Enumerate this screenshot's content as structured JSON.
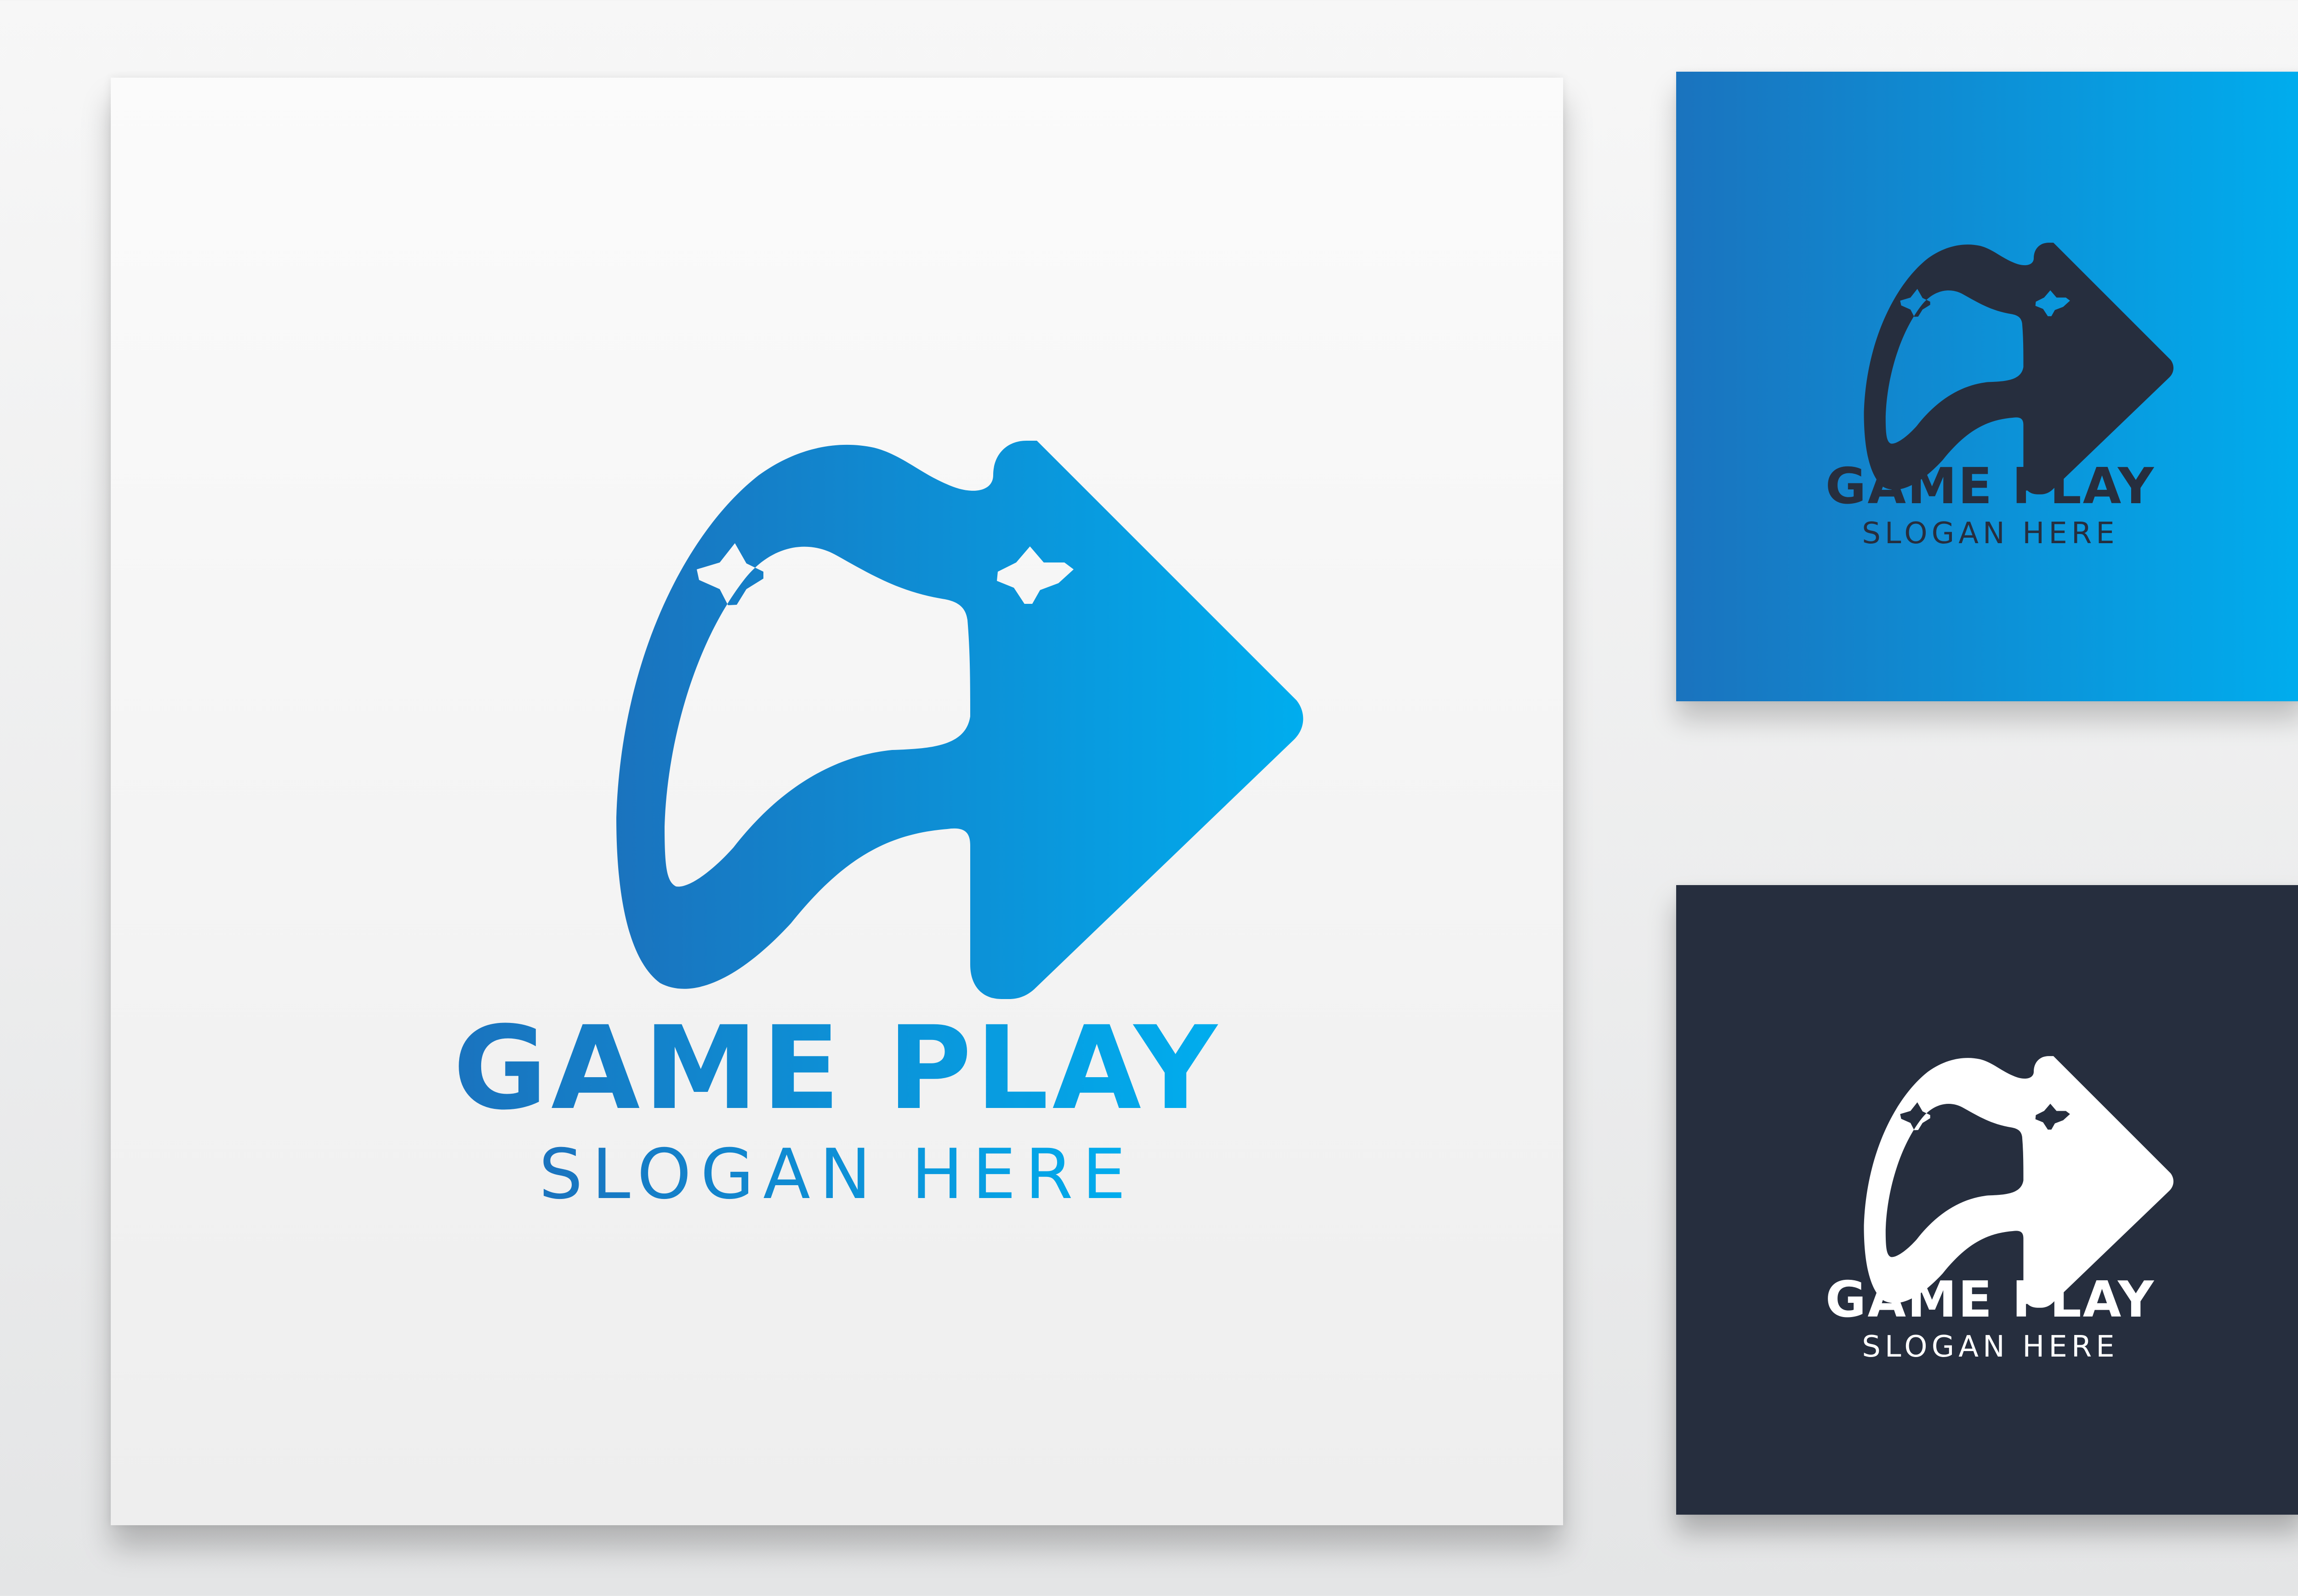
{
  "colors": {
    "gradient_start": "#1a73be",
    "gradient_end": "#00adee",
    "navy": "#262e3e",
    "white": "#ffffff",
    "paper": "#f4f4f4"
  },
  "logo": {
    "icon": "gamepad-play-icon",
    "name": "GAME PLAY",
    "slogan": "SLOGAN HERE"
  },
  "variants": [
    {
      "id": "main",
      "background": "light",
      "mark_color": "blue-gradient"
    },
    {
      "id": "blue",
      "background": "blue-gradient",
      "mark_color": "navy"
    },
    {
      "id": "dark",
      "background": "navy",
      "mark_color": "white"
    }
  ]
}
